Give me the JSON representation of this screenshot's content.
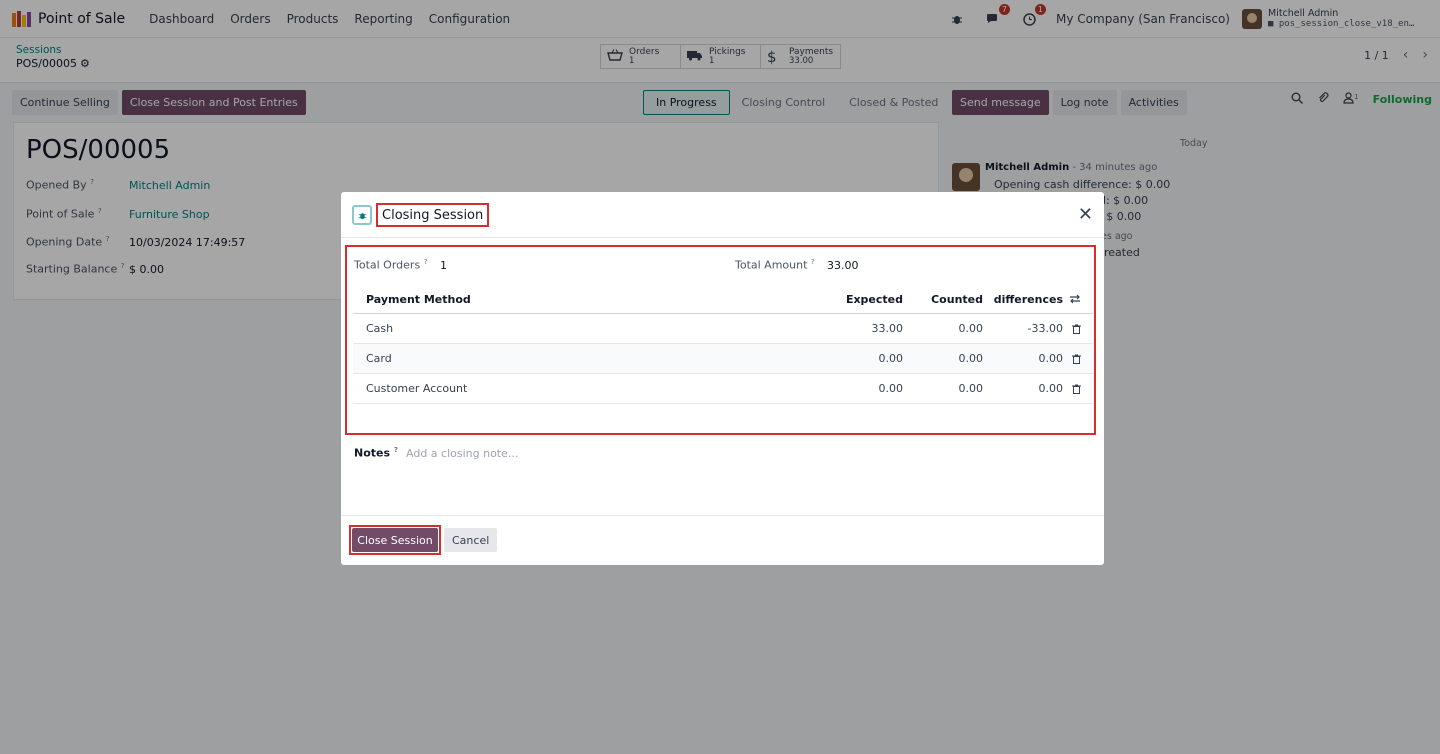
{
  "nav": {
    "app_name": "Point of Sale",
    "menu": [
      "Dashboard",
      "Orders",
      "Products",
      "Reporting",
      "Configuration"
    ],
    "icons": [
      "bug-icon",
      "chat-icon",
      "clock-icon"
    ],
    "chat_badge": "7",
    "activity_badge": "1",
    "company": "My Company (San Francisco)",
    "user_name": "Mitchell Admin",
    "db_name": "pos_session_close_v18_en…"
  },
  "control": {
    "breadcrumb_parent": "Sessions",
    "breadcrumb_current": "POS/00005",
    "stats": [
      {
        "label": "Orders",
        "value": "1",
        "icon": "basket-icon"
      },
      {
        "label": "Pickings",
        "value": "1",
        "icon": "truck-icon"
      },
      {
        "label": "Payments",
        "value": "33.00",
        "icon": "dollar-icon"
      }
    ],
    "pager": "1 / 1"
  },
  "form": {
    "continue_label": "Continue Selling",
    "close_post_label": "Close Session and Post Entries",
    "status": [
      "In Progress",
      "Closing Control",
      "Closed & Posted"
    ],
    "record_name": "POS/00005",
    "fields": {
      "opened_by_label": "Opened By",
      "opened_by": "Mitchell Admin",
      "pos_label": "Point of Sale",
      "pos": "Furniture Shop",
      "opening_date_label": "Opening Date",
      "opening_date": "10/03/2024 17:49:57",
      "starting_balance_label": "Starting Balance",
      "starting_balance": "$ 0.00"
    }
  },
  "chatter": {
    "send_message": "Send message",
    "log_note": "Log note",
    "activities": "Activities",
    "followers_count": "1",
    "following": "Following",
    "today": "Today",
    "author": "Mitchell Admin",
    "time": "- 34 minutes ago",
    "line1": "Opening cash difference: $ 0.00",
    "line2_frag": "d: $ 0.00",
    "line3_frag": ": $ 0.00",
    "line4_frag": "es ago",
    "line5_frag": "reated"
  },
  "modal": {
    "title": "Closing Session",
    "total_orders_label": "Total Orders",
    "total_orders": "1",
    "total_amount_label": "Total Amount",
    "total_amount": "33.00",
    "table_headers": {
      "method": "Payment Method",
      "expected": "Expected",
      "counted": "Counted",
      "diff": "differences"
    },
    "rows": [
      {
        "method": "Cash",
        "expected": "33.00",
        "counted": "0.00",
        "diff": "-33.00"
      },
      {
        "method": "Card",
        "expected": "0.00",
        "counted": "0.00",
        "diff": "0.00"
      },
      {
        "method": "Customer Account",
        "expected": "0.00",
        "counted": "0.00",
        "diff": "0.00"
      }
    ],
    "notes_label": "Notes",
    "notes_placeholder": "Add a closing note...",
    "close_button": "Close Session",
    "cancel_button": "Cancel"
  },
  "colors": {
    "brand": "#714b67",
    "link": "#017e84",
    "highlight": "#d32f2f",
    "following": "#16a34a"
  }
}
